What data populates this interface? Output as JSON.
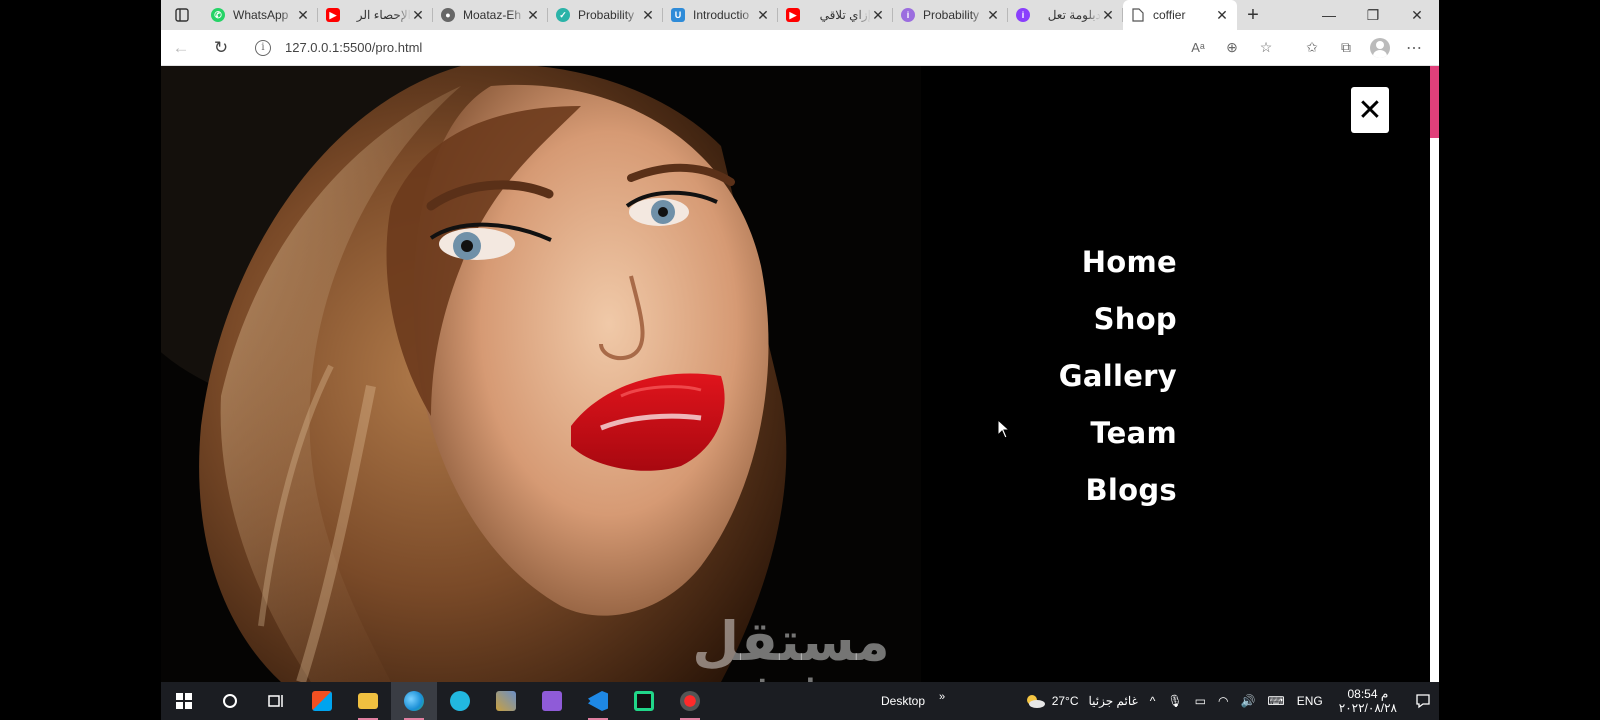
{
  "browser": {
    "tabs": [
      {
        "title": "WhatsApp",
        "icon": "whatsapp-icon",
        "color": "#25d366"
      },
      {
        "title": "الإحصاء الر",
        "icon": "youtube-icon",
        "color": "#ff0000"
      },
      {
        "title": "Moataz-Eh",
        "icon": "github-icon",
        "color": "#333333"
      },
      {
        "title": "Probability",
        "icon": "course-icon",
        "color": "#2bb3a8"
      },
      {
        "title": "Introductio",
        "icon": "udacity-icon",
        "color": "#2e8bd8"
      },
      {
        "title": "إزاي تلاقي",
        "icon": "youtube-icon",
        "color": "#ff0000"
      },
      {
        "title": "Probability",
        "icon": "course-icon",
        "color": "#9b6ddf"
      },
      {
        "title": "دبلومة تعل",
        "icon": "course-icon",
        "color": "#8a3ffc"
      },
      {
        "title": "coffier",
        "icon": "page-icon",
        "color": "#ffffff"
      }
    ],
    "active_tab_index": 8,
    "url": "127.0.0.1:5500/pro.html"
  },
  "page": {
    "close_symbol": "✕",
    "menu": [
      "Home",
      "Shop",
      "Gallery",
      "Team",
      "Blogs"
    ],
    "accent_color": "#e0407a"
  },
  "watermark": {
    "arabic": "مستقل",
    "latin": "mostaql.com"
  },
  "taskbar": {
    "desktop_label": "Desktop",
    "weather_temp": "27°C",
    "weather_text": "غائم جزئيا",
    "language": "ENG",
    "time": "08:54 م",
    "date": "٢٠٢٢/٠٨/٢٨"
  }
}
